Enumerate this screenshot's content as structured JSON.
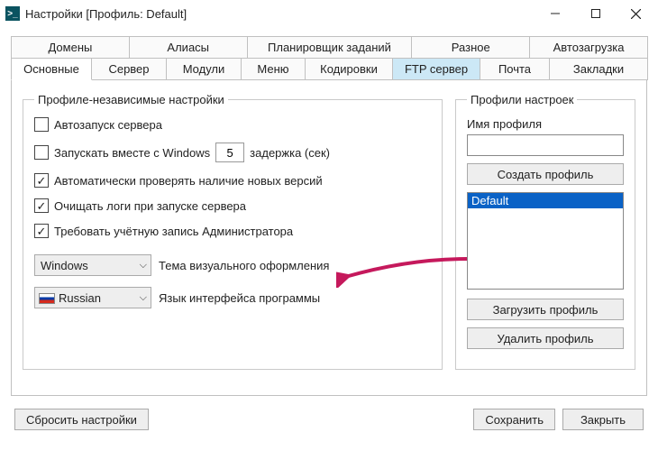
{
  "window": {
    "title": "Настройки [Профиль: Default]"
  },
  "tabs": {
    "row1": [
      "Домены",
      "Алиасы",
      "Планировщик заданий",
      "Разное",
      "Автозагрузка"
    ],
    "row2": [
      "Основные",
      "Сервер",
      "Модули",
      "Меню",
      "Кодировки",
      "FTP сервер",
      "Почта",
      "Закладки"
    ],
    "active": "Основные",
    "highlighted": "FTP сервер"
  },
  "group_independent": {
    "legend": "Профиле-независимые настройки",
    "checkboxes": {
      "autostart": {
        "label": "Автозапуск сервера",
        "checked": false
      },
      "start_with_windows": {
        "label": "Запускать вместе с Windows",
        "checked": false
      },
      "delay_value": "5",
      "delay_suffix": "задержка (сек)",
      "check_updates": {
        "label": "Автоматически проверять наличие новых версий",
        "checked": true
      },
      "clear_logs": {
        "label": "Очищать логи при запуске сервера",
        "checked": true
      },
      "require_admin": {
        "label": "Требовать учётную запись Администратора",
        "checked": true
      }
    },
    "theme": {
      "value": "Windows",
      "label": "Тема визуального оформления"
    },
    "language": {
      "value": "Russian",
      "label": "Язык интерфейса программы"
    }
  },
  "group_profiles": {
    "legend": "Профили настроек",
    "name_label": "Имя профиля",
    "name_value": "",
    "create": "Создать профиль",
    "list": [
      "Default"
    ],
    "selected": "Default",
    "load": "Загрузить профиль",
    "delete": "Удалить профиль"
  },
  "footer": {
    "reset": "Сбросить настройки",
    "save": "Сохранить",
    "close": "Закрыть"
  }
}
